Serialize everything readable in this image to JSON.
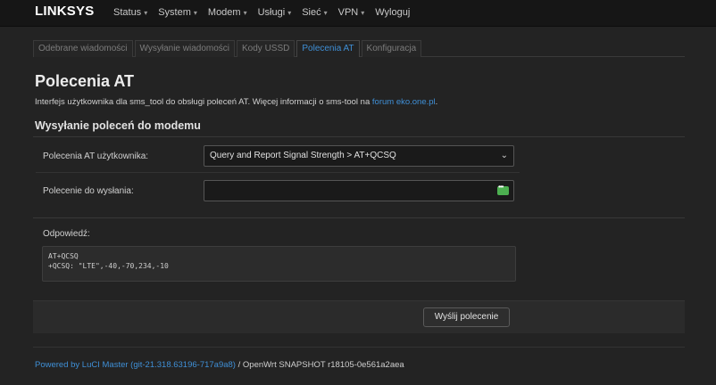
{
  "navbar": {
    "brand": "LINKSYS",
    "menu": [
      {
        "label": "Status",
        "caret": "▾"
      },
      {
        "label": "System",
        "caret": "▾"
      },
      {
        "label": "Modem",
        "caret": "▾"
      },
      {
        "label": "Usługi",
        "caret": "▾"
      },
      {
        "label": "Sieć",
        "caret": "▾"
      },
      {
        "label": "VPN",
        "caret": "▾"
      },
      {
        "label": "Wyloguj",
        "caret": ""
      }
    ]
  },
  "tabs": [
    {
      "label": "Odebrane wiadomości",
      "active": false
    },
    {
      "label": "Wysyłanie wiadomości",
      "active": false
    },
    {
      "label": "Kody USSD",
      "active": false
    },
    {
      "label": "Polecenia AT",
      "active": true
    },
    {
      "label": "Konfiguracja",
      "active": false
    }
  ],
  "page": {
    "title": "Polecenia AT",
    "description": "Interfejs użytkownika dla sms_tool do obsługi poleceń AT. Więcej informacji o sms-tool na ",
    "description_link": "forum eko.one.pl",
    "description_end": "."
  },
  "section": {
    "title": "Wysyłanie poleceń do modemu",
    "user_commands_label": "Polecenia AT użytkownika:",
    "user_commands_selected": "Query and Report Signal Strength > AT+QCSQ",
    "command_label": "Polecenie do wysłania:",
    "command_value": "",
    "send_icon": "send-icon",
    "response_label": "Odpowiedź:",
    "response_lines": [
      "AT+QCSQ",
      "+QCSQ: \"LTE\",-40,-70,234,-10"
    ],
    "send_button": "Wyślij polecenie"
  },
  "footer": {
    "link_text": "Powered by LuCI Master (git-21.318.63196-717a9a8)",
    "rest": " / OpenWrt SNAPSHOT r18105-0e561a2aea"
  },
  "colors": {
    "background": "#232323",
    "navbar": "#161616",
    "accent": "#3f8fd6",
    "send_icon": "#4caf50"
  }
}
